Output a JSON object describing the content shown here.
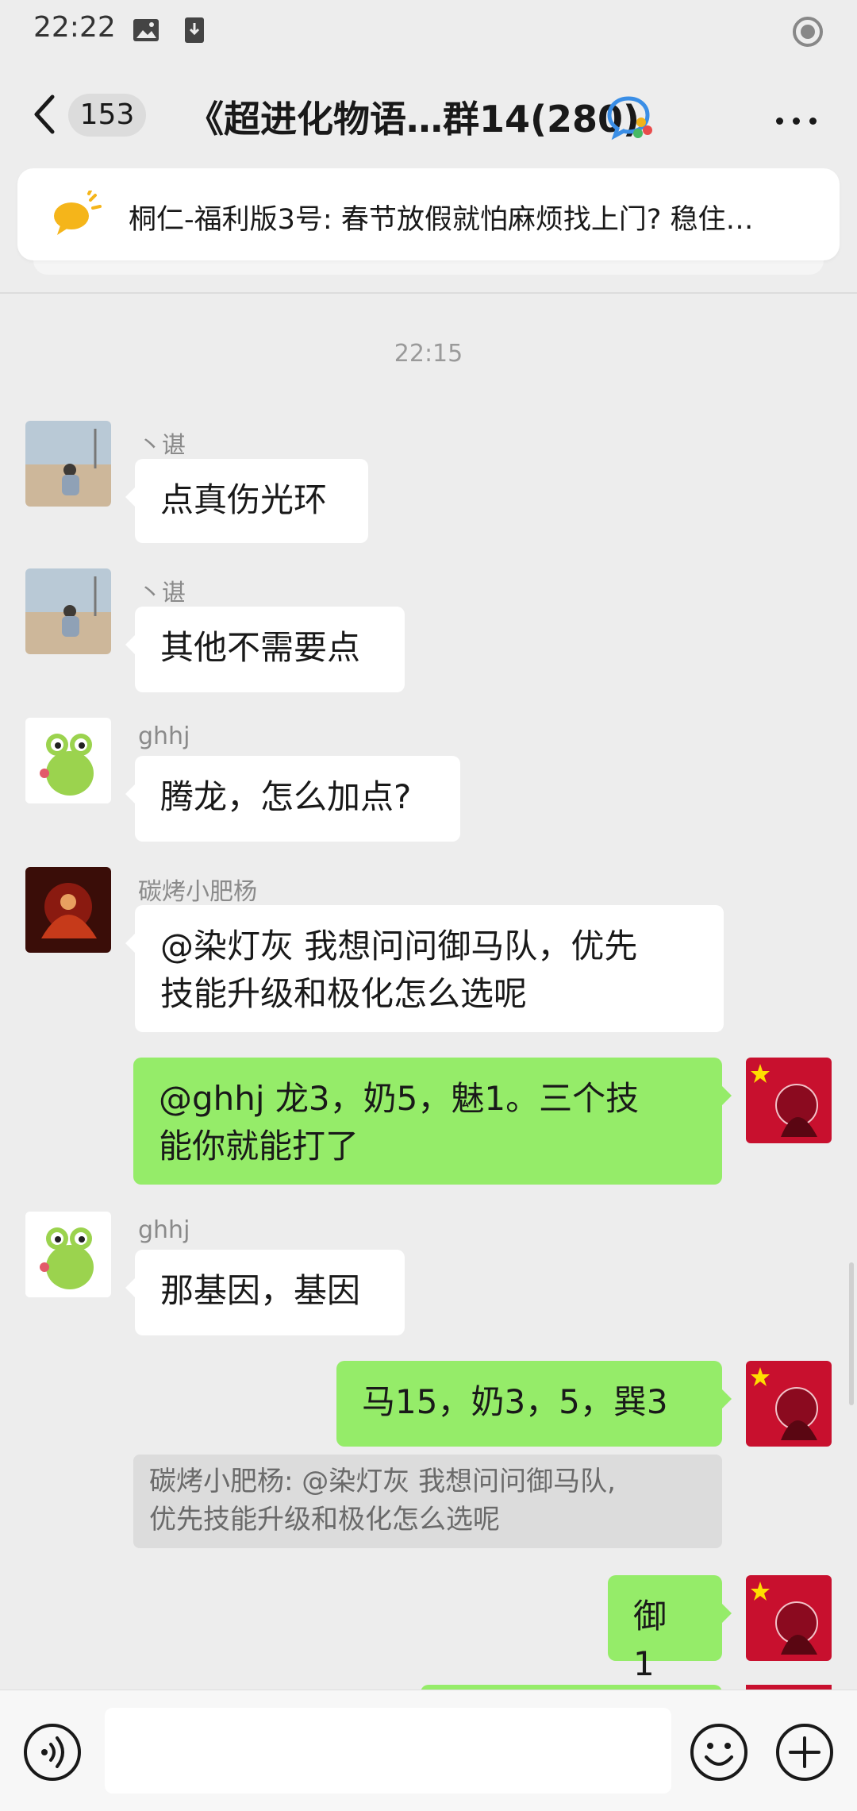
{
  "status": {
    "time": "22:22"
  },
  "header": {
    "unread": "153",
    "title": "《超进化物语…群14(280)"
  },
  "notice": {
    "text": "桐仁-福利版3号: 春节放假就怕麻烦找上门? 稳住…"
  },
  "timestamp": "22:15",
  "messages": [
    {
      "nick": "丶谌",
      "text": "点真伤光环"
    },
    {
      "nick": "丶谌",
      "text": "其他不需要点"
    },
    {
      "nick": "ghhj",
      "text": "腾龙，怎么加点?"
    },
    {
      "nick": "碳烤小肥杨",
      "text_line1": "@染灯灰  我想问问御马队，优先",
      "text_line2": "技能升级和极化怎么选呢"
    },
    {
      "text_line1": "@ghhj  龙3，奶5，魅1。三个技",
      "text_line2": "能你就能打了"
    },
    {
      "nick": "ghhj",
      "text": "那基因，基因"
    },
    {
      "text": "马15，奶3，5，巽3"
    },
    {
      "text": "御 1"
    }
  ],
  "quote": {
    "line1": "碳烤小肥杨: @染灯灰 我想问问御马队,",
    "line2": "优先技能升级和极化怎么选呢"
  },
  "input": {
    "value": ""
  },
  "colors": {
    "my_bubble": "#95ec69",
    "background": "#ededed"
  }
}
